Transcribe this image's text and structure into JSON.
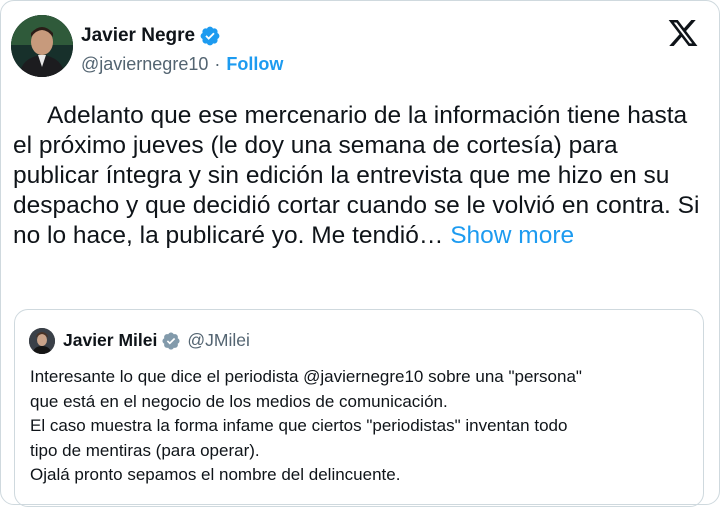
{
  "tweet": {
    "author_name": "Javier Negre",
    "handle": "@javiernegre10",
    "separator": "·",
    "follow_label": "Follow",
    "text": "Adelanto que ese mercenario de la información tiene hasta el próximo jueves (le doy una semana de cortesía) para publicar íntegra y sin edición la entrevista que me hizo en su despacho y que decidió cortar cuando se le volvió en contra. Si no lo hace, la publicaré yo. Me tendió…",
    "show_more_label": "Show more"
  },
  "quoted_tweet": {
    "author_name": "Javier Milei",
    "handle": "@JMilei",
    "lines": [
      "Interesante lo que dice el periodista @javiernegre10 sobre una \"persona\"",
      "que está en el negocio de los medios de comunicación.",
      "El caso muestra la forma infame que ciertos \"periodistas\"  inventan todo",
      "tipo de mentiras (para operar).",
      "Ojalá pronto sepamos el nombre del delincuente."
    ]
  },
  "icons": {
    "verified": "verified-badge-icon",
    "platform": "x-logo-icon"
  },
  "colors": {
    "accent": "#1d9bf0",
    "text": "#0f1419",
    "muted": "#536471",
    "border": "#cfd9de"
  }
}
